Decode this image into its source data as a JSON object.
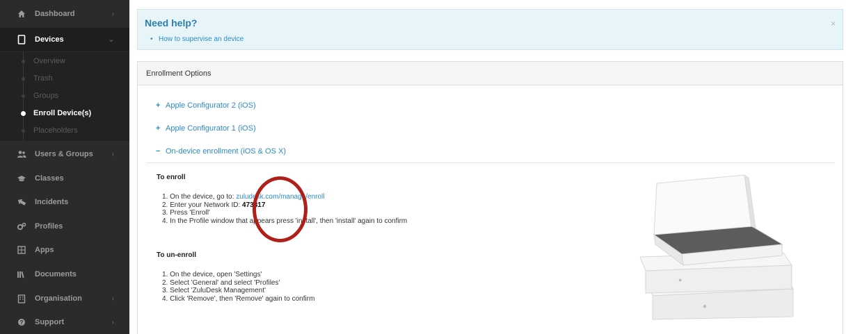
{
  "sidebar": {
    "items": [
      {
        "label": "Dashboard",
        "icon": "home-icon"
      },
      {
        "label": "Devices",
        "icon": "device-icon"
      },
      {
        "label": "Users & Groups",
        "icon": "users-icon"
      },
      {
        "label": "Classes",
        "icon": "classes-icon"
      },
      {
        "label": "Incidents",
        "icon": "incidents-icon"
      },
      {
        "label": "Profiles",
        "icon": "profiles-icon"
      },
      {
        "label": "Apps",
        "icon": "apps-icon"
      },
      {
        "label": "Documents",
        "icon": "documents-icon"
      },
      {
        "label": "Organisation",
        "icon": "organisation-icon"
      },
      {
        "label": "Support",
        "icon": "support-icon"
      }
    ],
    "submenu": [
      "Overview",
      "Trash",
      "Groups",
      "Enroll Device(s)",
      "Placeholders"
    ]
  },
  "help": {
    "title": "Need help?",
    "link": "How to supervise an device",
    "close": "×"
  },
  "panel": {
    "title": "Enrollment Options",
    "accordions": [
      {
        "sign": "+",
        "label": "Apple Configurator 2 (iOS)"
      },
      {
        "sign": "+",
        "label": "Apple Configurator 1 (iOS)"
      },
      {
        "sign": "−",
        "label": "On-device enrollment (iOS & OS X)"
      }
    ]
  },
  "enroll": {
    "title": "To enroll",
    "step1_prefix": "1. On the device, go to: ",
    "step1_link": "zuludesk.com/manage/enroll",
    "step2_prefix": "2. Enter your Network ID: ",
    "network_id": "473317",
    "step3": "3. Press 'Enroll'",
    "step4": "4. In the Profile window that appears press 'install', then 'install' again to confirm"
  },
  "unenroll": {
    "title": "To un-enroll",
    "steps": [
      "1. On the device, open 'Settings'",
      "2. Select 'General' and select 'Profiles'",
      "3. Select 'ZuluDesk Management'",
      "4. Click 'Remove', then 'Remove' again to confirm"
    ]
  },
  "colors": {
    "sidebar_bg": "#2b2b2b",
    "link": "#2a8cc4",
    "highlight_circle": "#b0201b"
  }
}
